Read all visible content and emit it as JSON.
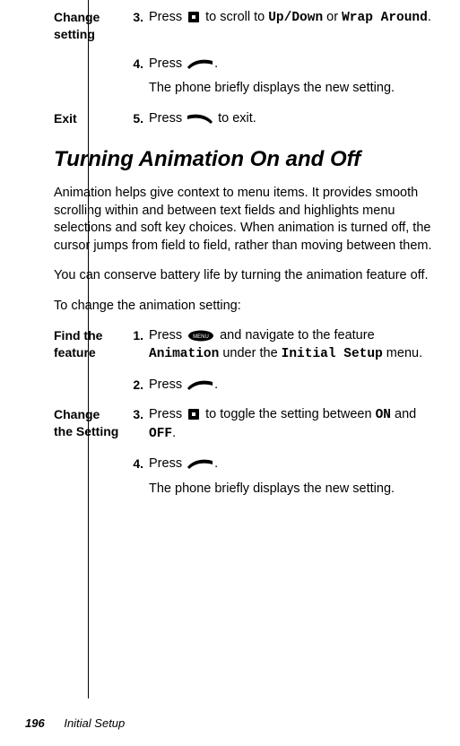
{
  "rows_top": [
    {
      "label": "Change setting",
      "items": [
        {
          "num": "3.",
          "prefix": "Press ",
          "icon": "nav-key-icon",
          "mid": " to scroll to ",
          "mono1": "Up/Down",
          "or": " or ",
          "mono2": "Wrap Around",
          "suffix": "."
        },
        {
          "num": "4.",
          "prefix": "Press ",
          "icon": "softkey-right-icon",
          "suffix": ".",
          "follow": "The phone briefly displays the new setting."
        }
      ]
    },
    {
      "label": "Exit",
      "items": [
        {
          "num": "5.",
          "prefix": "Press ",
          "icon": "softkey-left-icon",
          "mid": " to exit.",
          "suffix": ""
        }
      ]
    }
  ],
  "section_title": "Turning Animation On and Off",
  "intro": [
    "Animation helps give context to menu items. It provides smooth scrolling within and between text fields and highlights menu selections and soft key choices. When animation is turned off, the cursor jumps from field to field, rather than moving between them.",
    "You can conserve battery life by turning the animation feature off.",
    "To change the animation setting:"
  ],
  "rows_bottom": [
    {
      "label": "Find the feature",
      "items": [
        {
          "num": "1.",
          "prefix": "Press ",
          "icon": "menu-key-icon",
          "mid": " and navigate to the feature ",
          "mono1": "Animation",
          "or": " under the ",
          "mono2": "Initial Setup",
          "suffix": " menu."
        },
        {
          "num": "2.",
          "prefix": "Press ",
          "icon": "softkey-right-icon",
          "suffix": "."
        }
      ]
    },
    {
      "label": "Change the Setting",
      "items": [
        {
          "num": "3.",
          "prefix": "Press ",
          "icon": "nav-key-icon",
          "mid": " to toggle the setting between ",
          "mono1": "ON",
          "or": " and ",
          "mono2": "OFF",
          "suffix": "."
        },
        {
          "num": "4.",
          "prefix": "Press ",
          "icon": "softkey-right-icon",
          "suffix": ".",
          "follow": "The phone briefly displays the new setting."
        }
      ]
    }
  ],
  "footer": {
    "page": "196",
    "title": "Initial Setup"
  }
}
